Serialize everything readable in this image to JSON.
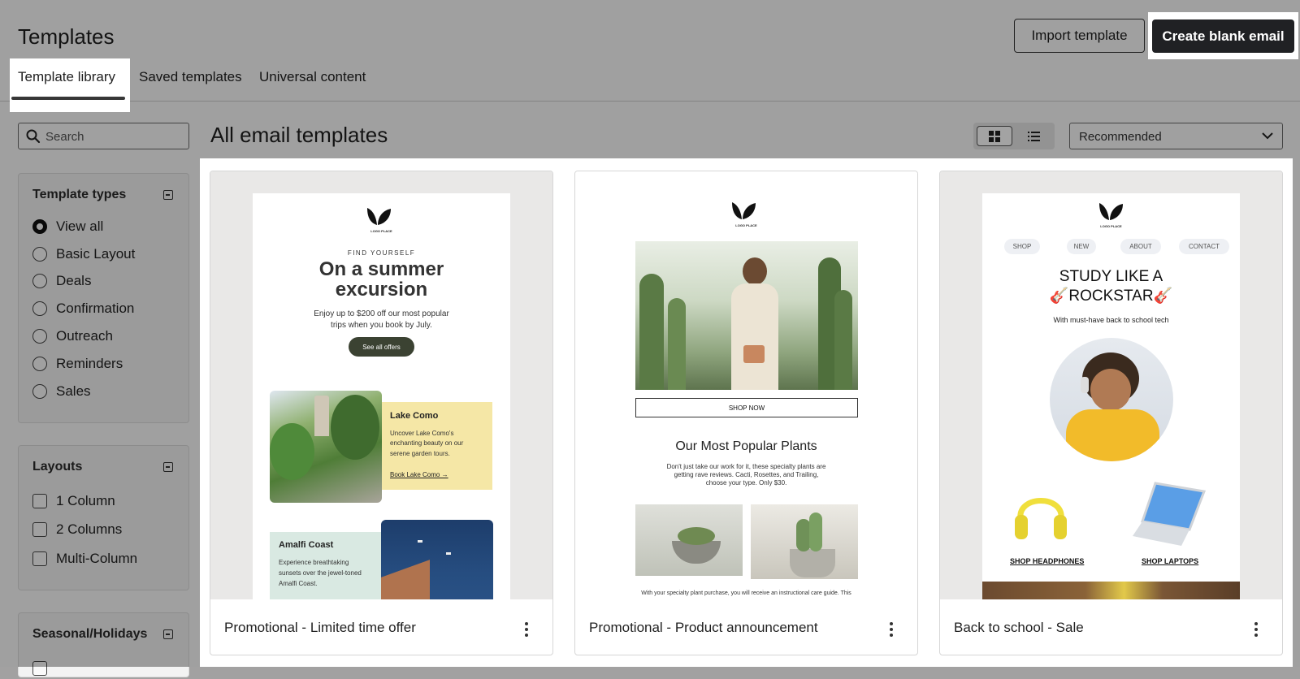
{
  "header": {
    "title": "Templates",
    "import_label": "Import template",
    "create_label": "Create blank email"
  },
  "tabs": [
    {
      "label": "Template library",
      "active": true
    },
    {
      "label": "Saved templates",
      "active": false
    },
    {
      "label": "Universal content",
      "active": false
    }
  ],
  "search": {
    "placeholder": "Search"
  },
  "filters": {
    "template_types": {
      "title": "Template types",
      "options": [
        "View all",
        "Basic Layout",
        "Deals",
        "Confirmation",
        "Outreach",
        "Reminders",
        "Sales"
      ],
      "selected": "View all"
    },
    "layouts": {
      "title": "Layouts",
      "options": [
        "1 Column",
        "2 Columns",
        "Multi-Column"
      ]
    },
    "seasonal": {
      "title": "Seasonal/Holidays"
    }
  },
  "main": {
    "heading": "All email templates",
    "view_mode": "grid",
    "sort_value": "Recommended"
  },
  "cards": [
    {
      "name": "Promotional - Limited time offer",
      "preview": {
        "logo_text": "LOGO PLACE",
        "eyebrow": "FIND YOURSELF",
        "headline_1": "On a summer",
        "headline_2": "excursion",
        "body_1": "Enjoy up to $200 off our most popular",
        "body_2": "trips when you book by July.",
        "cta": "See all offers",
        "block1_title": "Lake Como",
        "block1_body_1": "Uncover Lake Como's",
        "block1_body_2": "enchanting beauty on our",
        "block1_body_3": "serene garden tours.",
        "block1_link": "Book Lake Como →",
        "block2_title": "Amalfi Coast",
        "block2_body_1": "Experience breathtaking",
        "block2_body_2": "sunsets over the jewel-toned",
        "block2_body_3": "Amalfi Coast."
      }
    },
    {
      "name": "Promotional - Product announcement",
      "preview": {
        "logo_text": "LOGO PLACE",
        "cta": "SHOP NOW",
        "headline": "Our Most Popular Plants",
        "body_1": "Don't just take our work for it, these specialty plants are",
        "body_2": "getting rave reviews. Cacti, Rosettes, and Trailing,",
        "body_3": "choose your type. Only $30.",
        "footer": "With your specialty plant purchase, you will receive an instructional care guide. This"
      }
    },
    {
      "name": "Back to school - Sale",
      "preview": {
        "logo_text": "LOGO PLACE",
        "nav": [
          "SHOP",
          "NEW",
          "ABOUT",
          "CONTACT"
        ],
        "headline_1": "STUDY LIKE A",
        "headline_2": "🎸ROCKSTAR🎸",
        "subhead": "With must-have back to school tech",
        "link_1": "SHOP HEADPHONES",
        "link_2": "SHOP LAPTOPS"
      }
    }
  ],
  "colors": {
    "primary_button": "#202124",
    "green_cta": "#3b4232",
    "yellow_block": "#f5e7a6",
    "mint_block": "#d9e9e2",
    "headphones": "#f0df3c"
  }
}
